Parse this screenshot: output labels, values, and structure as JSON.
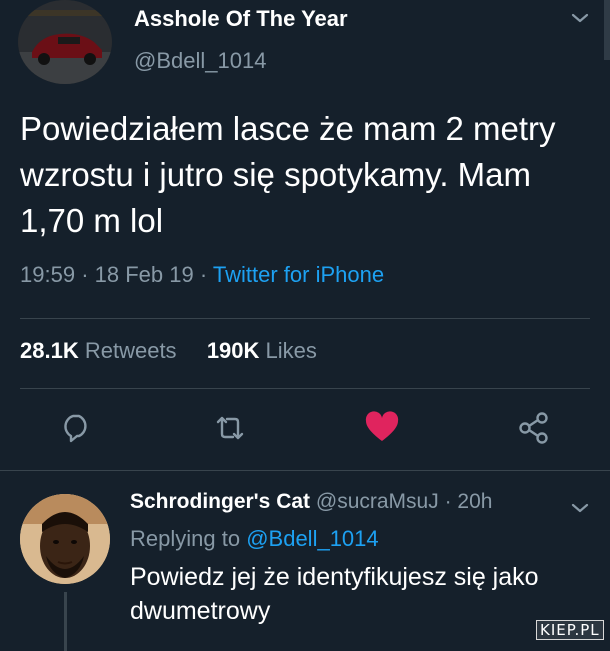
{
  "tweet": {
    "author_name": "Asshole Of The Year",
    "author_handle": "@Bdell_1014",
    "text": "Powiedziałem lasce że mam 2 metry wzrostu i jutro się spotykamy. Mam 1,70 m lol",
    "time": "19:59",
    "date": "18 Feb 19",
    "source": "Twitter for iPhone",
    "retweet_count": "28.1K",
    "retweet_label": "Retweets",
    "like_count": "190K",
    "like_label": "Likes",
    "like_color": "#e0245e",
    "icon_color": "#8899a6"
  },
  "reply": {
    "author_name": "Schrodinger's Cat",
    "author_handle": "@sucraMsuJ",
    "time_ago": "20h",
    "replying_prefix": "Replying to",
    "replying_to": "@Bdell_1014",
    "text": "Powiedz jej że identyfikujesz się jako dwumetrowy"
  },
  "watermark": "KIEP.PL",
  "icons": [
    "chevron-down-icon",
    "reply-icon",
    "retweet-icon",
    "heart-icon",
    "share-icon"
  ]
}
